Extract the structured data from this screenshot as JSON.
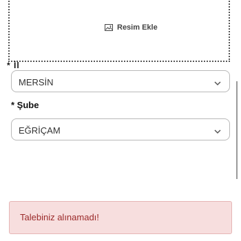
{
  "upload": {
    "label": "Resim Ekle",
    "icon": "image-icon"
  },
  "form": {
    "required_marker": "* İl",
    "city_select": {
      "value": "MERSİN"
    },
    "branch_label": "* Şube",
    "branch_select": {
      "value": "EĞRİÇAM"
    }
  },
  "alert": {
    "message": "Talebiniz alınamadı!",
    "bg_color": "#f7dede",
    "text_color": "#9b2a2a"
  }
}
